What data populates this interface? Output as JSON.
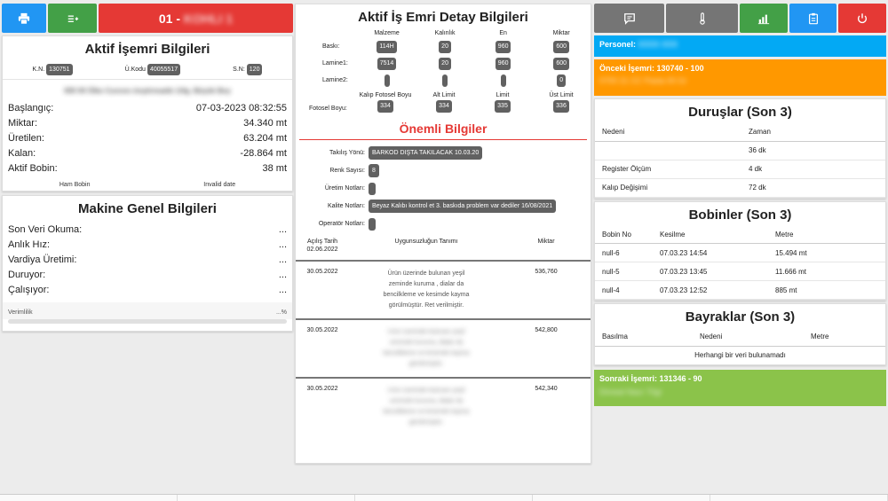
{
  "topbar": {
    "print_icon": "printer-icon",
    "add_icon": "list-add-icon",
    "machine_label": "01 -",
    "machine_name_blurred": "KOHLI 1"
  },
  "aktif_isemri": {
    "title": "Aktif İşemri Bilgileri",
    "kn_label": "K.N.",
    "kn_value": "130751",
    "ukodu_label": "Ü.Kodu",
    "ukodu_value": "40055517",
    "sn_label": "S.N:",
    "sn_value": "120",
    "product_name_blurred": "000 00 Ölke Cuvvon önştirmadık 1/4g. Büyük Boy",
    "rows": [
      {
        "k": "Başlangıç:",
        "v": "07-03-2023 08:32:55"
      },
      {
        "k": "Miktar:",
        "v": "34.340 mt"
      },
      {
        "k": "Üretilen:",
        "v": "63.204 mt"
      },
      {
        "k": "Kalan:",
        "v": "-28.864 mt"
      },
      {
        "k": "Aktif Bobin:",
        "v": "38 mt"
      }
    ],
    "ham_bobin": "Ham Bobin",
    "invalid_date": "Invalid date"
  },
  "makine_genel": {
    "title": "Makine Genel Bilgileri",
    "rows": [
      {
        "k": "Son Veri Okuma:",
        "v": "..."
      },
      {
        "k": "Anlık Hız:",
        "v": "..."
      },
      {
        "k": "Vardiya Üretimi:",
        "v": "..."
      },
      {
        "k": "Duruyor:",
        "v": "..."
      },
      {
        "k": "Çalışıyor:",
        "v": "..."
      }
    ],
    "verimlilik_label": "Verimlilik",
    "verimlilik_value": "...%",
    "verimlilik_fraction": 0
  },
  "detay": {
    "title": "Aktif İş Emri Detay Bilgileri",
    "cols": [
      "Malzeme",
      "Kalınlık",
      "En",
      "Miktar"
    ],
    "rows": [
      {
        "label": "Baskı:",
        "values": [
          "114H",
          "20",
          "960",
          "600"
        ]
      },
      {
        "label": "Lamine1:",
        "values": [
          "7514",
          "20",
          "960",
          "600"
        ]
      },
      {
        "label": "Lamine2:",
        "values": [
          "",
          "",
          "",
          "0"
        ]
      }
    ],
    "fotosel_label": "Fotosel Boyu:",
    "fotosel_cols": [
      "Kalıp Fotosel Boyu",
      "Alt Limit",
      "Limit",
      "Üst Limit"
    ],
    "fotosel_values": [
      "334",
      "334",
      "335",
      "336"
    ]
  },
  "onemli": {
    "title": "Önemli Bilgiler",
    "notes": [
      {
        "label": "Takılış Yönü:",
        "value": "BARKOD DIŞTA TAKILACAK 10.03.20"
      },
      {
        "label": "Renk Sayısı:",
        "value": "8"
      },
      {
        "label": "Üretim Notları:",
        "value": ""
      },
      {
        "label": "Kalite Notları:",
        "value": "Beyaz Kalıbı kontrol et 3. baskıda problem var dediler 16/08/2021"
      },
      {
        "label": "Operatör Notları:",
        "value": ""
      }
    ],
    "fault_head": [
      "Açılış Tarih",
      "Uygunsuzluğun Tanımı",
      "Miktar"
    ],
    "faults": [
      {
        "date": "02.06.2022",
        "desc": "",
        "qty": "",
        "blurred": false
      },
      {
        "date": "30.05.2022",
        "desc": "Ürün üzerinde bulunan yeşil zeminde kuruma , dialar da bencilkleme ve kesimde kayma görülmüştür. Ret verilmiştir.",
        "qty": "536,760",
        "blurred": false
      },
      {
        "date": "30.05.2022",
        "desc": "Ürün üzerinde bulunan yeşil zeminde kuruma, dialar da bencilkleme ve kesimde kayma görülmüştür.",
        "qty": "542,800",
        "blurred": true
      },
      {
        "date": "30.05.2022",
        "desc": "Ürün üzerinde bulunan yeşil zeminde kuruma, dialar da bencilkleme ve kesimde kayma görülmüştür.",
        "qty": "542,340",
        "blurred": true
      }
    ]
  },
  "right": {
    "personel_label": "Personel:",
    "personel_blurred": "XXXX XXX",
    "onceki_label": "Önceki İşemri: 130740 - 100",
    "onceki_blurred": "0700 21 CC Pasta 00 Gr",
    "duruslar": {
      "title": "Duruşlar (Son 3)",
      "cols": [
        "Nedeni",
        "Zaman"
      ],
      "rows": [
        [
          "",
          "36 dk"
        ],
        [
          "Register Ölçüm",
          "4 dk"
        ],
        [
          "Kalıp Değişimi",
          "72 dk"
        ]
      ]
    },
    "bobinler": {
      "title": "Bobinler (Son 3)",
      "cols": [
        "Bobin No",
        "Kesilme",
        "Metre"
      ],
      "rows": [
        [
          "null-6",
          "07.03.23 14:54",
          "15.494 mt"
        ],
        [
          "null-5",
          "07.03.23 13:45",
          "11.666 mt"
        ],
        [
          "null-4",
          "07.03.23 12:52",
          "885 mt"
        ]
      ]
    },
    "bayraklar": {
      "title": "Bayraklar (Son 3)",
      "cols": [
        "Basılma",
        "Nedeni",
        "Metre"
      ],
      "empty": "Herhangi bir veri bulunamadı"
    },
    "sonraki_label": "Sonraki İşemri: 131346 - 90",
    "sonraki_blurred": "Dimeal Naur 70gr"
  },
  "colors": {
    "blue": "#2196f3",
    "green": "#43a047",
    "red": "#e53935",
    "gray": "#757575",
    "cyan": "#03a9f4",
    "orange": "#ff9800",
    "lime": "#8bc34a",
    "accent_red": "#e53935"
  }
}
